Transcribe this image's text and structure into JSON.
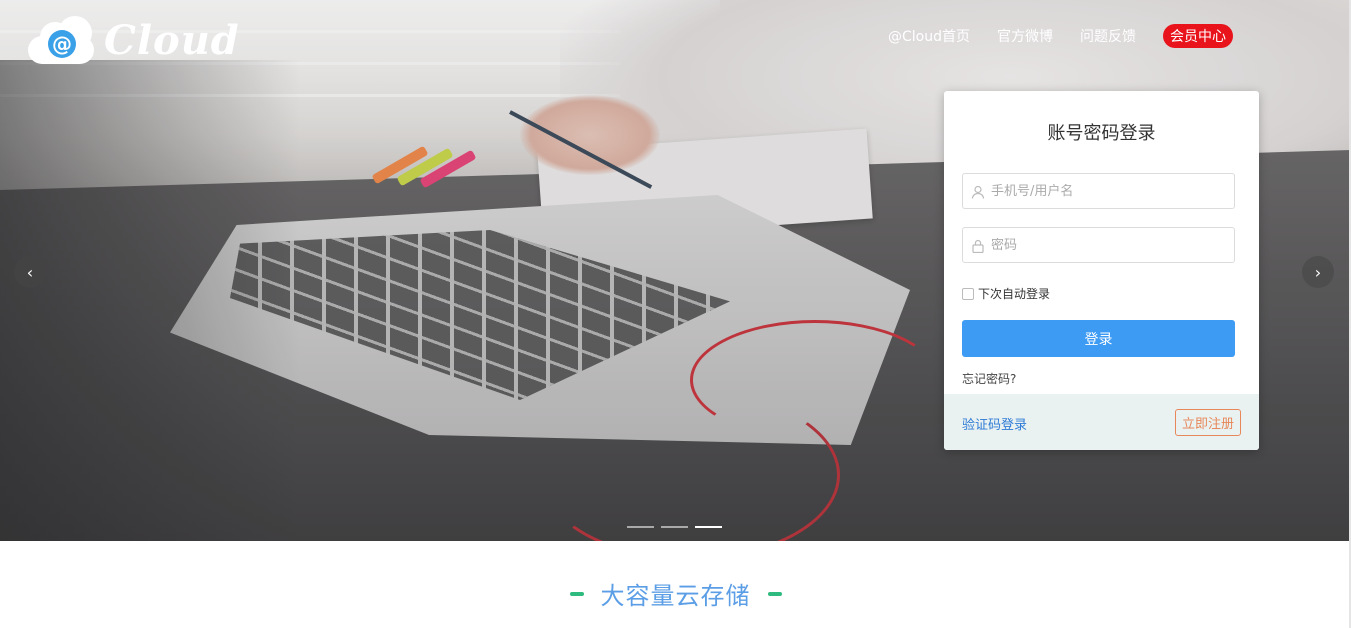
{
  "header": {
    "logo_text": "Cloud",
    "logo_symbol": "@",
    "nav": [
      {
        "label": "@Cloud首页"
      },
      {
        "label": "官方微博"
      },
      {
        "label": "问题反馈"
      },
      {
        "label": "会员中心"
      }
    ]
  },
  "carousel": {
    "prev_glyph": "‹",
    "next_glyph": "›",
    "slide_count": 3,
    "active_slide": 3
  },
  "login": {
    "title": "账号密码登录",
    "username_placeholder": "手机号/用户名",
    "password_placeholder": "密码",
    "remember_label": "下次自动登录",
    "submit_label": "登录",
    "forgot_label": "忘记密码?",
    "sms_login_label": "验证码登录",
    "register_label": "立即注册"
  },
  "section": {
    "title": "大容量云存储"
  },
  "colors": {
    "primary_blue": "#3d9bf4",
    "member_red": "#e8131b",
    "register_orange": "#e7875a",
    "section_title_blue": "#5b9ee6",
    "section_dash_green": "#2fba7f",
    "logo_at_blue": "#3aa0e8"
  },
  "icons": [
    "cloud-logo-icon",
    "user-icon",
    "lock-icon",
    "chevron-left-icon",
    "chevron-right-icon",
    "checkbox-icon"
  ]
}
